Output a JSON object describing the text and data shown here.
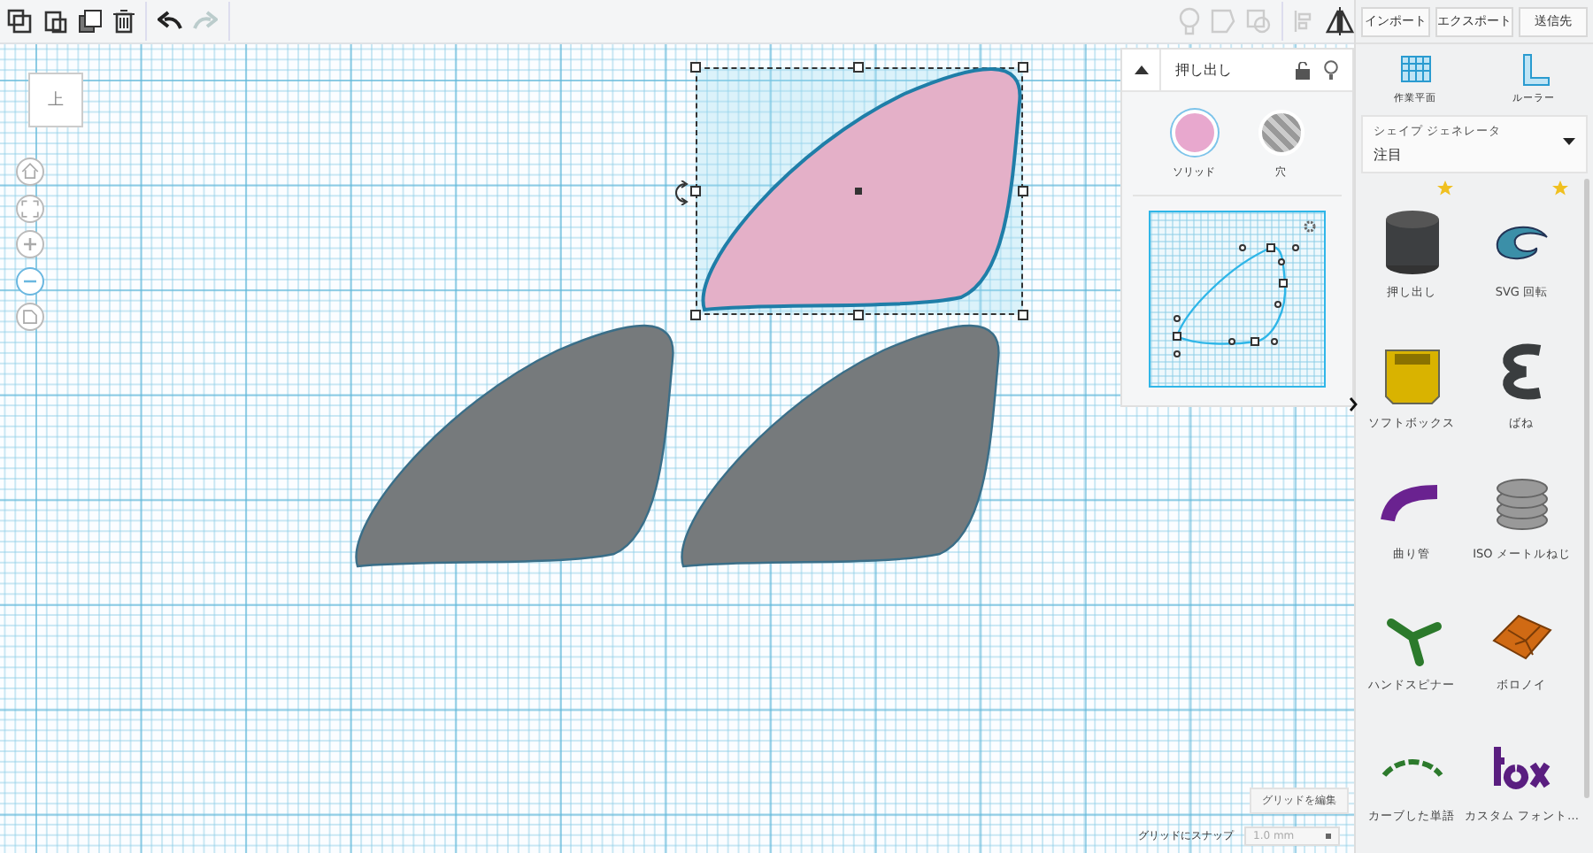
{
  "toolbar": {
    "buttons": [
      "インポート",
      "エクスポート",
      "送信先"
    ]
  },
  "view_cube": {
    "label": "上"
  },
  "canvas": {
    "shapes": [
      {
        "selected": true
      },
      {
        "selected": false
      },
      {
        "selected": false
      }
    ]
  },
  "inspector": {
    "title": "押し出し",
    "options": [
      {
        "label": "ソリッド",
        "selected": true
      },
      {
        "label": "穴",
        "selected": false
      }
    ]
  },
  "library": {
    "tools": [
      "作業平面",
      "ルーラー"
    ],
    "dropdown": {
      "label": "シェイプ ジェネレータ",
      "value": "注目"
    },
    "items": [
      {
        "name": "押し出し",
        "starred": true
      },
      {
        "name": "SVG 回転",
        "starred": true
      },
      {
        "name": "ソフトボックス",
        "starred": false
      },
      {
        "name": "ばね",
        "starred": false
      },
      {
        "name": "曲り管",
        "starred": false
      },
      {
        "name": "ISO メートルねじ",
        "starred": false
      },
      {
        "name": "ハンドスピナー",
        "starred": false
      },
      {
        "name": "ボロノイ",
        "starred": false
      },
      {
        "name": "カーブした単語",
        "starred": false
      },
      {
        "name": "カスタム フォント…",
        "starred": false
      }
    ]
  },
  "grid": {
    "edit_button": "グリッドを編集",
    "snap_label": "グリッドにスナップ",
    "snap_value": "1.0 mm"
  }
}
